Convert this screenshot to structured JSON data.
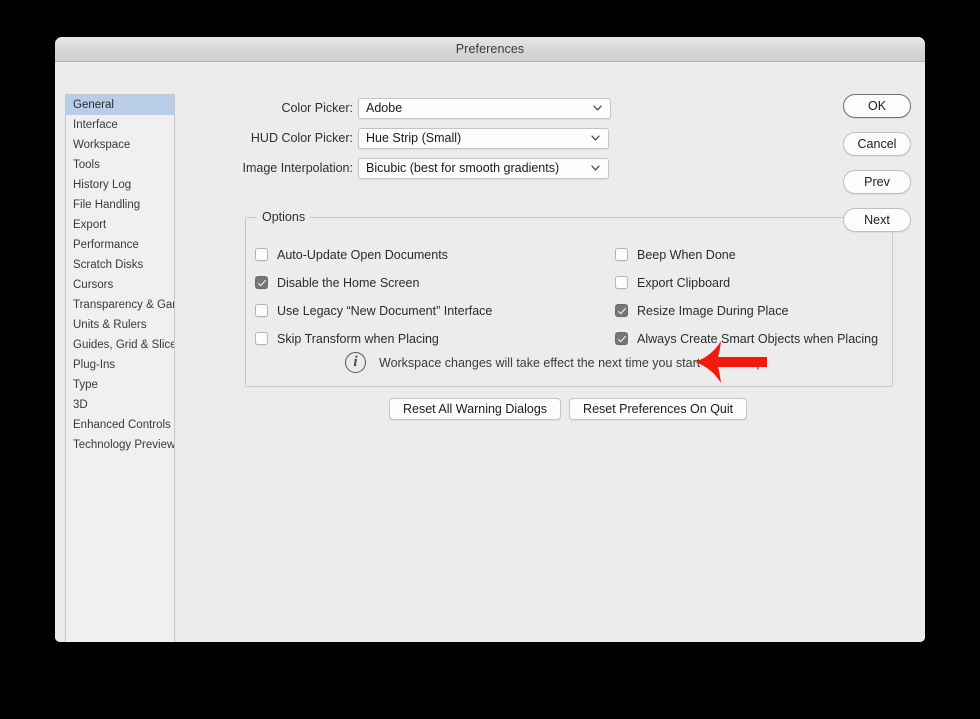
{
  "window": {
    "title": "Preferences"
  },
  "sidebar": {
    "items": [
      {
        "label": "General",
        "selected": true
      },
      {
        "label": "Interface",
        "selected": false
      },
      {
        "label": "Workspace",
        "selected": false
      },
      {
        "label": "Tools",
        "selected": false
      },
      {
        "label": "History Log",
        "selected": false
      },
      {
        "label": "File Handling",
        "selected": false
      },
      {
        "label": "Export",
        "selected": false
      },
      {
        "label": "Performance",
        "selected": false
      },
      {
        "label": "Scratch Disks",
        "selected": false
      },
      {
        "label": "Cursors",
        "selected": false
      },
      {
        "label": "Transparency & Gamut",
        "selected": false
      },
      {
        "label": "Units & Rulers",
        "selected": false
      },
      {
        "label": "Guides, Grid & Slices",
        "selected": false
      },
      {
        "label": "Plug-Ins",
        "selected": false
      },
      {
        "label": "Type",
        "selected": false
      },
      {
        "label": "3D",
        "selected": false
      },
      {
        "label": "Enhanced Controls",
        "selected": false
      },
      {
        "label": "Technology Previews",
        "selected": false
      }
    ]
  },
  "fields": [
    {
      "label": "Color Picker:",
      "value": "Adobe"
    },
    {
      "label": "HUD Color Picker:",
      "value": "Hue Strip (Small)"
    },
    {
      "label": "Image Interpolation:",
      "value": "Bicubic (best for smooth gradients)"
    }
  ],
  "options_group": {
    "title": "Options",
    "left_column": [
      {
        "label": "Auto-Update Open Documents",
        "checked": false
      },
      {
        "label": "Disable the Home Screen",
        "checked": true
      },
      {
        "label": "Use Legacy “New Document” Interface",
        "checked": false
      },
      {
        "label": "Skip Transform when Placing",
        "checked": false
      }
    ],
    "right_column": [
      {
        "label": "Beep When Done",
        "checked": false
      },
      {
        "label": "Export Clipboard",
        "checked": false
      },
      {
        "label": "Resize Image During Place",
        "checked": true
      },
      {
        "label": "Always Create Smart Objects when Placing",
        "checked": true
      }
    ]
  },
  "info": {
    "icon": "info-circle-icon",
    "text": "Workspace changes will take effect the next time you start Photoshop."
  },
  "reset_buttons": [
    {
      "label": "Reset All Warning Dialogs"
    },
    {
      "label": "Reset Preferences On Quit"
    }
  ],
  "side_buttons": [
    {
      "label": "OK",
      "default": true
    },
    {
      "label": "Cancel",
      "default": false
    },
    {
      "label": "Prev",
      "default": false
    },
    {
      "label": "Next",
      "default": false
    }
  ],
  "annotation": {
    "name": "red-arrow-pointing-left",
    "color": "#f4190d"
  },
  "colors": {
    "dialog_background": "#ececec",
    "sidebar_selection": "#b8cde8",
    "checkbox_checked": "#767676",
    "desktop_background": "#000000"
  }
}
